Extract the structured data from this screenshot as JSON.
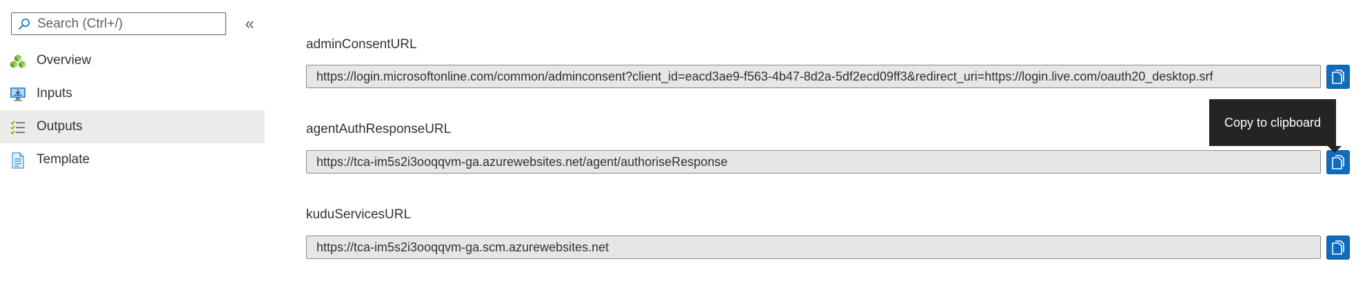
{
  "sidebar": {
    "search": {
      "placeholder": "Search (Ctrl+/)",
      "value": ""
    },
    "collapse_glyph": "«",
    "items": [
      {
        "label": "Overview",
        "icon": "overview-icon",
        "selected": false
      },
      {
        "label": "Inputs",
        "icon": "inputs-icon",
        "selected": false
      },
      {
        "label": "Outputs",
        "icon": "outputs-icon",
        "selected": true
      },
      {
        "label": "Template",
        "icon": "template-icon",
        "selected": false
      }
    ]
  },
  "outputs": [
    {
      "label": "adminConsentURL",
      "value": "https://login.microsoftonline.com/common/adminconsent?client_id=eacd3ae9-f563-4b47-8d2a-5df2ecd09ff3&redirect_uri=https://login.live.com/oauth20_desktop.srf"
    },
    {
      "label": "agentAuthResponseURL",
      "value": "https://tca-im5s2i3ooqqvm-ga.azurewebsites.net/agent/authoriseResponse"
    },
    {
      "label": "kuduServicesURL",
      "value": "https://tca-im5s2i3ooqqvm-ga.scm.azurewebsites.net"
    }
  ],
  "tooltip": {
    "text": "Copy to clipboard"
  },
  "colors": {
    "accent": "#0f6cbd",
    "selected_bg": "#edebe9",
    "field_bg": "#e6e6e6",
    "tooltip_bg": "#252423"
  }
}
